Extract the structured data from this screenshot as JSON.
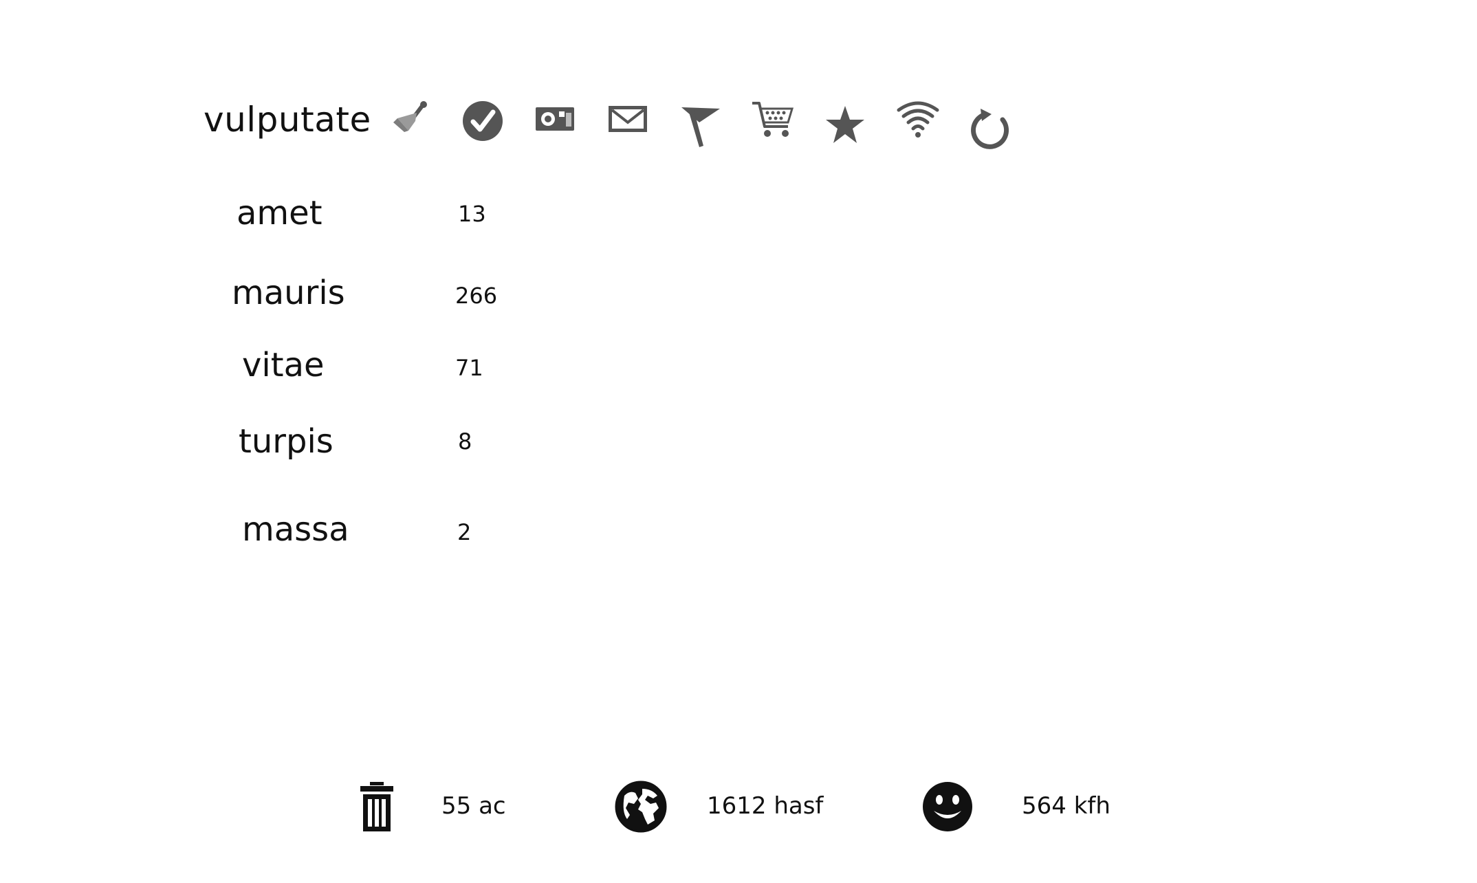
{
  "header": {
    "title": "vulputate",
    "icons": [
      "broom-icon",
      "check-circle-icon",
      "camera-icon",
      "mail-icon",
      "flag-icon",
      "cart-icon",
      "star-icon",
      "wifi-icon",
      "refresh-icon"
    ]
  },
  "rows": [
    {
      "label": "amet",
      "value": "13"
    },
    {
      "label": "mauris",
      "value": "266"
    },
    {
      "label": "vitae",
      "value": "71"
    },
    {
      "label": "turpis",
      "value": "8"
    },
    {
      "label": "massa",
      "value": "2"
    }
  ],
  "footer": {
    "items": [
      {
        "icon": "trash-icon",
        "text": "55 ac"
      },
      {
        "icon": "globe-icon",
        "text": "1612 hasf"
      },
      {
        "icon": "smiley-icon",
        "text": "564 kfh"
      }
    ]
  },
  "colors": {
    "icon_gray": "#555555",
    "icon_light_gray": "#9a9a9a",
    "text": "#111111",
    "background": "#ffffff"
  }
}
